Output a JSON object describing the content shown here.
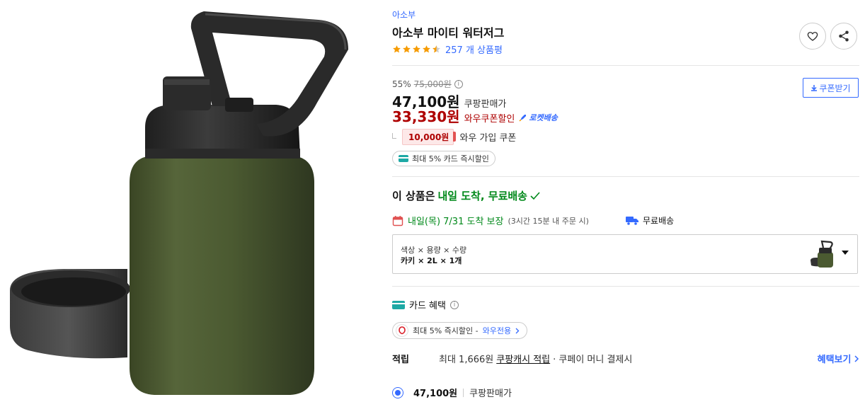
{
  "product": {
    "brand": "아소부",
    "title": "아소부 마이티 워터저그",
    "rating": 4.5,
    "review_count": "257 개 상품평"
  },
  "pricing": {
    "discount_percent": "55%",
    "original_price": "75,000원",
    "sale_price": "47,100원",
    "sale_label": "쿠팡판매가",
    "wow_price": "33,330원",
    "wow_label": "와우쿠폰할인",
    "rocket_label": "로켓배송",
    "coupon_amount": "10,000원",
    "coupon_label": "와우 가입 쿠폰",
    "card_discount": "최대 5% 카드 즉시할인",
    "coupon_button": "쿠폰받기"
  },
  "delivery": {
    "headline_prefix": "이 상품은",
    "headline_highlight": "내일 도착, 무료배송",
    "arrival_text": "내일(목) 7/31 도착 보장",
    "arrival_note": "(3시간 15분 내 주문 시)",
    "shipping_label": "무료배송"
  },
  "option": {
    "labels": "색상 × 용량 × 수량",
    "values": "카키 × 2L × 1개"
  },
  "benefits": {
    "card_title": "카드 혜택",
    "wow_discount": "최대 5% 즉시할인 -",
    "wow_only": "와우전용",
    "reward_label": "적립",
    "reward_amount": "최대 1,666원",
    "reward_cash": "쿠팡캐시 적립",
    "reward_tail": "· 쿠페이 머니 결제시",
    "benefit_link": "혜택보기"
  },
  "seller": {
    "price": "47,100원",
    "name": "쿠팡판매가"
  },
  "colors": {
    "accent_blue": "#346aff",
    "wow_red": "#ae0000",
    "delivery_green": "#00891a",
    "jug_green": "#4b5a31"
  }
}
